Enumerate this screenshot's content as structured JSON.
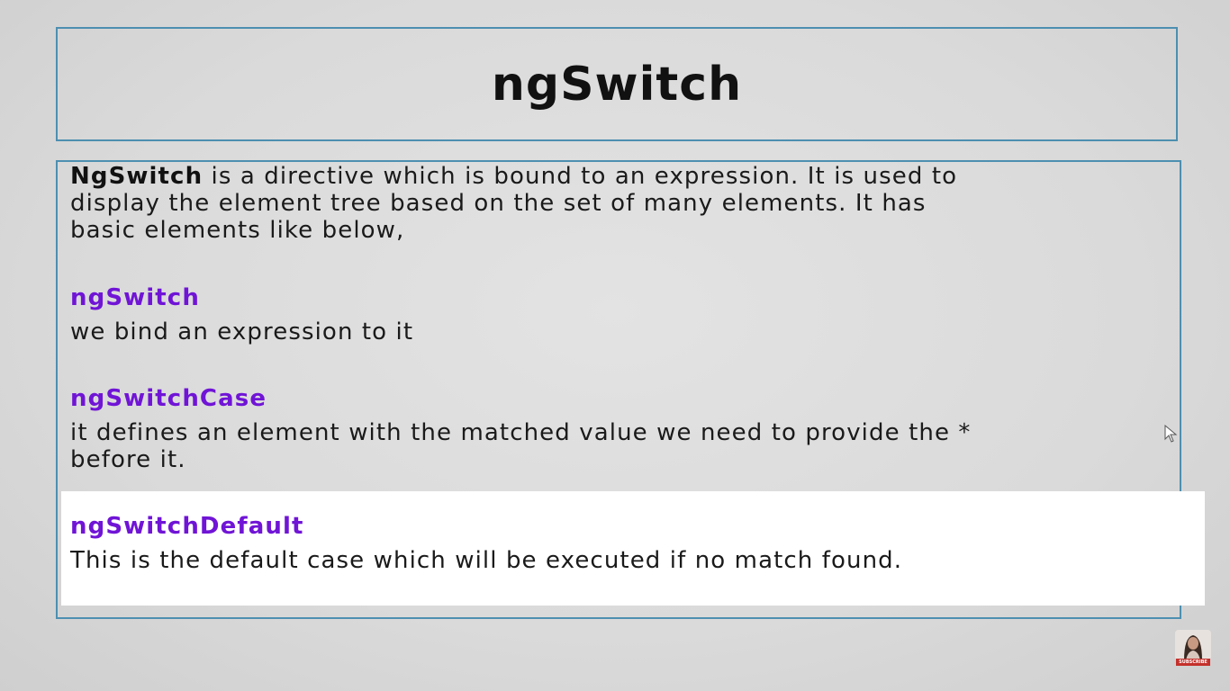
{
  "slide": {
    "title": "ngSwitch",
    "intro": {
      "bold_lead": "NgSwitch",
      "line1_rest": " is a directive which is bound to an expression. It is used to",
      "line2": "display the element tree based on the set of many elements. It has",
      "line3": "basic elements like below,"
    },
    "items": [
      {
        "term": "ngSwitch",
        "description": "we bind an expression to it"
      },
      {
        "term": "ngSwitchCase",
        "description_line1": "it defines an element with the matched value we need to provide the *",
        "description_line2": "before it."
      },
      {
        "term": "ngSwitchDefault",
        "description": "This is the default case which will be executed if no match found."
      }
    ]
  },
  "overlay": {
    "subscribe_label": "SUBSCRIBE",
    "avatar_icon": "presenter-avatar-icon",
    "cursor_icon": "mouse-pointer-icon"
  },
  "colors": {
    "term": "#7014d6",
    "border": "#4d8fb0",
    "highlight": "#ffffff"
  }
}
